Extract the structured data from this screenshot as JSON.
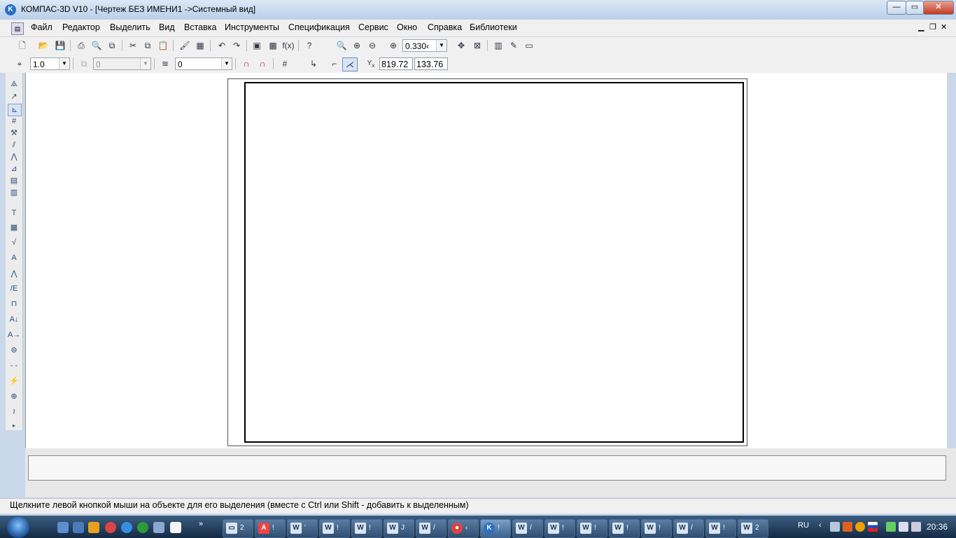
{
  "window": {
    "title": "КОМПАС-3D V10 - [Чертеж БЕЗ ИМЕНИ1 ->Системный вид]",
    "app_icon": "K",
    "controls": {
      "minimize": "—",
      "maximize": "▭",
      "close": "✕"
    }
  },
  "menu": {
    "items": [
      {
        "label": "Файл"
      },
      {
        "label": "Редактор"
      },
      {
        "label": "Выделить"
      },
      {
        "label": "Вид"
      },
      {
        "label": "Вставка"
      },
      {
        "label": "Инструменты"
      },
      {
        "label": "Спецификация"
      },
      {
        "label": "Сервис"
      },
      {
        "label": "Окно"
      },
      {
        "label": "Справка"
      },
      {
        "label": "Библиотеки"
      }
    ],
    "mdi_controls": {
      "minimize": "▁",
      "restore": "❐",
      "close": "✕"
    }
  },
  "toolbar_standard": {
    "zoom_value": "0.330‹"
  },
  "toolbar_current_state": {
    "step_value": "1.0",
    "layer_disabled_value": "0",
    "layer_value": "0",
    "coord_x": "819.72",
    "coord_y": "133.76"
  },
  "status": {
    "hint": "Щелкните левой кнопкой мыши на объекте для его выделения (вместе с Ctrl или Shift - добавить к выделенным)"
  },
  "taskbar": {
    "lang": "RU",
    "time": "20:36",
    "buttons": [
      {
        "icon": "folder-icon",
        "label": "2"
      },
      {
        "icon": "pdf-icon",
        "label": "!"
      },
      {
        "icon": "word-icon",
        "label": "'"
      },
      {
        "icon": "word-icon",
        "label": "!"
      },
      {
        "icon": "word-icon",
        "label": "!"
      },
      {
        "icon": "word-icon",
        "label": "J"
      },
      {
        "icon": "word-icon",
        "label": "/"
      },
      {
        "icon": "chrome-icon",
        "label": "‹"
      },
      {
        "icon": "kompas-icon",
        "label": "!"
      },
      {
        "icon": "word-icon",
        "label": "/"
      },
      {
        "icon": "word-icon",
        "label": "!"
      },
      {
        "icon": "word-icon",
        "label": "!"
      },
      {
        "icon": "word-icon",
        "label": "!"
      },
      {
        "icon": "word-icon",
        "label": "!"
      },
      {
        "icon": "word-icon",
        "label": "/"
      },
      {
        "icon": "word-icon",
        "label": "!"
      },
      {
        "icon": "word-icon",
        "label": "2"
      }
    ]
  }
}
